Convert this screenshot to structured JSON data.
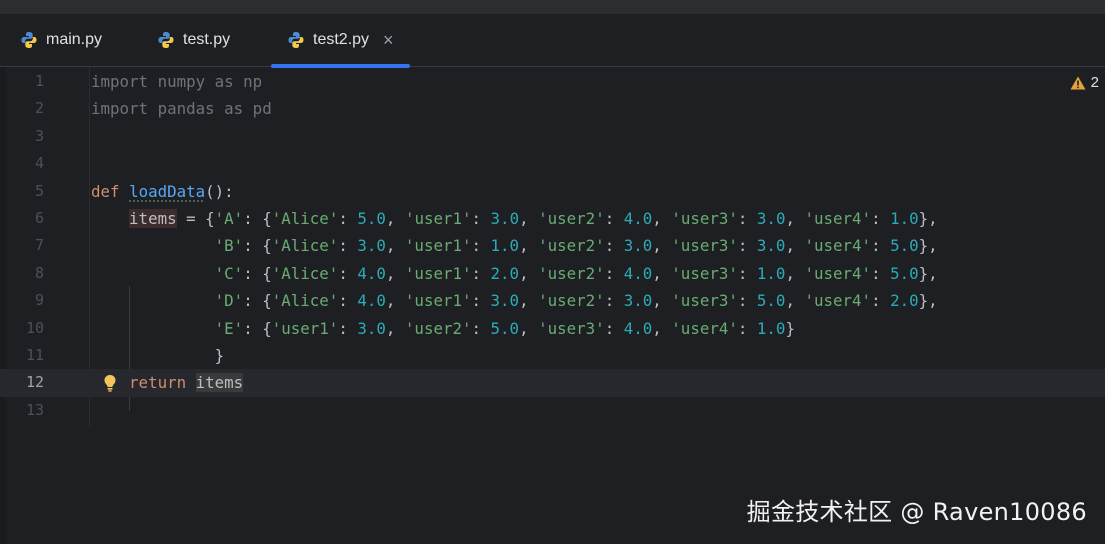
{
  "tabs": [
    {
      "label": "main.py",
      "icon": "python-icon"
    },
    {
      "label": "test.py",
      "icon": "python-icon"
    },
    {
      "label": "test2.py",
      "icon": "python-icon",
      "active": true
    }
  ],
  "tab_close": "×",
  "inspection": {
    "warning_count": "2",
    "icon": "warning-icon"
  },
  "code": {
    "l1": {
      "num": "1",
      "a": "import numpy as np"
    },
    "l2": {
      "num": "2",
      "a": "import pandas as pd"
    },
    "l3": {
      "num": "3"
    },
    "l4": {
      "num": "4"
    },
    "l5": {
      "num": "5",
      "kw": "def",
      "fn": "loadData",
      "rest": "():"
    },
    "l6": {
      "num": "6",
      "var": "items",
      "eq": " = {",
      "key": "'A'",
      "body": ": {",
      "k1": "'Alice'",
      "v1": "5.0",
      "k2": "'user1'",
      "v2": "3.0",
      "k3": "'user2'",
      "v3": "4.0",
      "k4": "'user3'",
      "v4": "3.0",
      "k5": "'user4'",
      "v5": "1.0",
      "end": "},"
    },
    "l7": {
      "num": "7",
      "key": "'B'",
      "k1": "'Alice'",
      "v1": "3.0",
      "k2": "'user1'",
      "v2": "1.0",
      "k3": "'user2'",
      "v3": "3.0",
      "k4": "'user3'",
      "v4": "3.0",
      "k5": "'user4'",
      "v5": "5.0",
      "end": "},"
    },
    "l8": {
      "num": "8",
      "key": "'C'",
      "k1": "'Alice'",
      "v1": "4.0",
      "k2": "'user1'",
      "v2": "2.0",
      "k3": "'user2'",
      "v3": "4.0",
      "k4": "'user3'",
      "v4": "1.0",
      "k5": "'user4'",
      "v5": "5.0",
      "end": "},"
    },
    "l9": {
      "num": "9",
      "key": "'D'",
      "k1": "'Alice'",
      "v1": "4.0",
      "k2": "'user1'",
      "v2": "3.0",
      "k3": "'user2'",
      "v3": "3.0",
      "k4": "'user3'",
      "v4": "5.0",
      "k5": "'user4'",
      "v5": "2.0",
      "end": "},"
    },
    "l10": {
      "num": "10",
      "key": "'E'",
      "k1": "'user1'",
      "v1": "3.0",
      "k2": "'user2'",
      "v2": "5.0",
      "k3": "'user3'",
      "v3": "4.0",
      "k4": "'user4'",
      "v4": "1.0",
      "end": "}"
    },
    "l11": {
      "num": "11",
      "a": "}"
    },
    "l12": {
      "num": "12",
      "kw": "return",
      "var": "items"
    },
    "l13": {
      "num": "13"
    }
  },
  "watermark": "掘金技术社区 @ Raven10086",
  "colors": {
    "background": "#1e1f22",
    "keyword": "#cf8e6d",
    "function": "#56a8f5",
    "string": "#6aab73",
    "number": "#2aacb8",
    "tab_active_underline": "#3574f0"
  }
}
